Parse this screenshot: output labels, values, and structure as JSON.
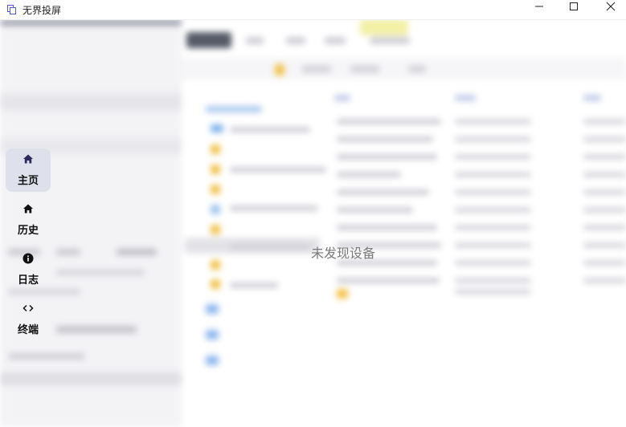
{
  "window": {
    "title": "无界投屏",
    "icon": "app-icon",
    "controls": {
      "minimize": "minimize-icon",
      "maximize": "maximize-icon",
      "close": "close-icon"
    }
  },
  "nav": [
    {
      "label": "主页",
      "icon": "home-icon",
      "active": true
    },
    {
      "label": "历史",
      "icon": "home-icon",
      "active": false
    },
    {
      "label": "日志",
      "icon": "info-icon",
      "active": false
    },
    {
      "label": "终端",
      "icon": "code-icon",
      "active": false
    }
  ],
  "empty_state": {
    "message": "未发现设备"
  },
  "colors": {
    "accent": "#2b2b5e",
    "active_bg": "#dcdeea",
    "muted_text": "#7a7a7a"
  }
}
